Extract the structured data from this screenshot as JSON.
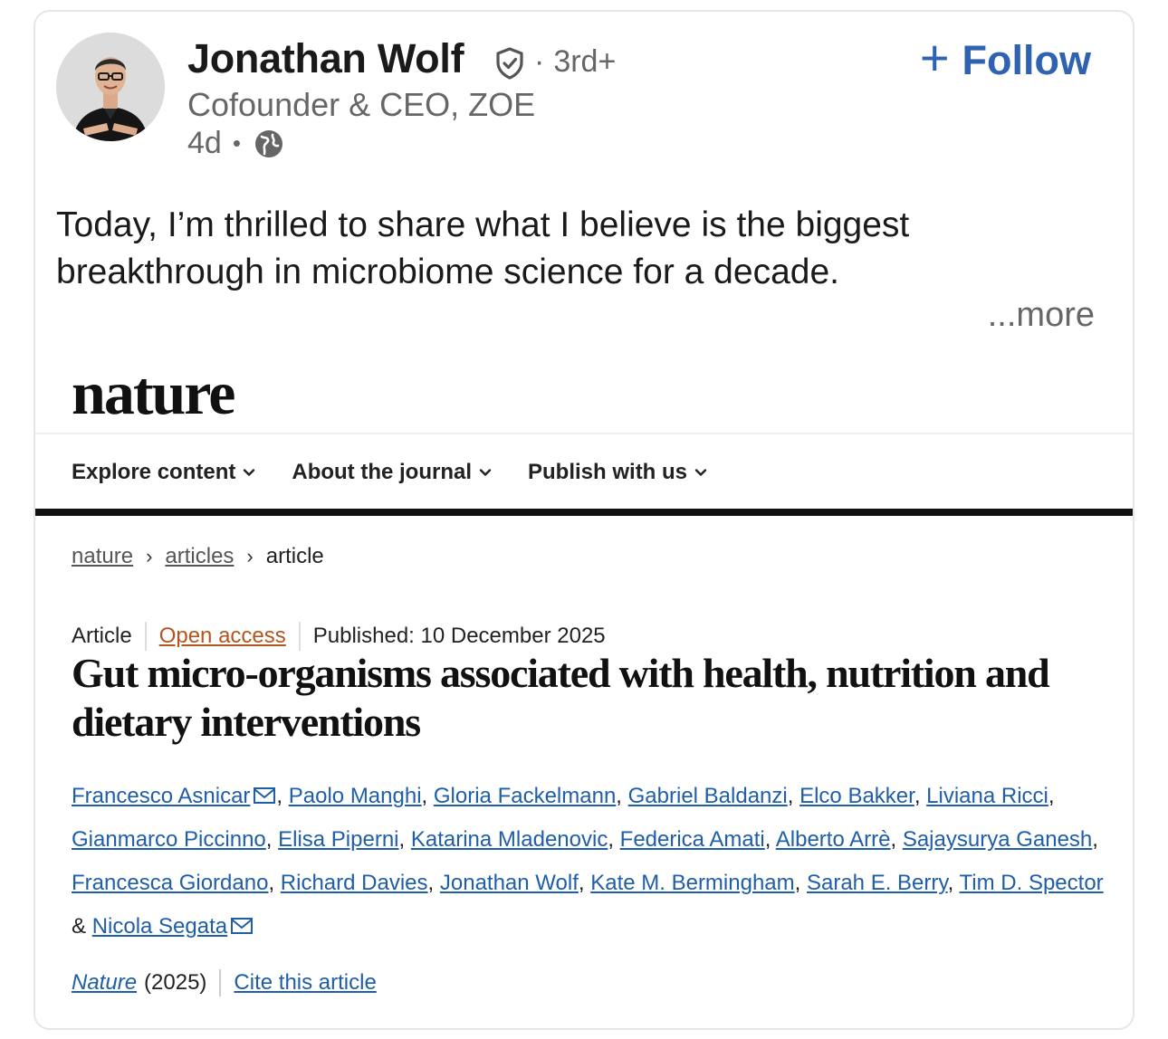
{
  "post": {
    "author_name": "Jonathan Wolf",
    "degree": "3rd+",
    "headline": "Cofounder & CEO, ZOE",
    "time": "4d",
    "follow_label": "Follow",
    "text": "Today, I’m thrilled to share what I believe is the biggest breakthrough in microbiome science for a decade.",
    "more_label": "...more",
    "icons": {
      "verified": "verified-shield-icon",
      "visibility": "globe-icon",
      "follow": "plus-icon"
    }
  },
  "nature": {
    "logo": "nature",
    "nav": [
      {
        "label": "Explore content"
      },
      {
        "label": "About the journal"
      },
      {
        "label": "Publish with us"
      }
    ],
    "breadcrumb": [
      "nature",
      "articles",
      "article"
    ],
    "article_type": "Article",
    "open_access": "Open access",
    "published": "Published: 10 December 2025",
    "title": "Gut micro-organisms associated with health, nutrition and dietary interventions",
    "authors": [
      "Francesco Asnicar",
      "Paolo Manghi",
      "Gloria Fackelmann",
      "Gabriel Baldanzi",
      "Elco Bakker",
      "Liviana Ricci",
      "Gianmarco Piccinno",
      "Elisa Piperni",
      "Katarina Mladenovic",
      "Federica Amati",
      "Alberto Arrè",
      "Sajaysurya Ganesh",
      "Francesca Giordano",
      "Richard Davies",
      "Jonathan Wolf",
      "Kate M. Bermingham",
      "Sarah E. Berry",
      "Tim D. Spector",
      "Nicola Segata"
    ],
    "journal": "Nature",
    "year": "(2025)",
    "cite_label": "Cite this article",
    "colors": {
      "link": "#1f5ea8",
      "open_access": "#b4551e",
      "follow": "#2f63b1"
    }
  }
}
